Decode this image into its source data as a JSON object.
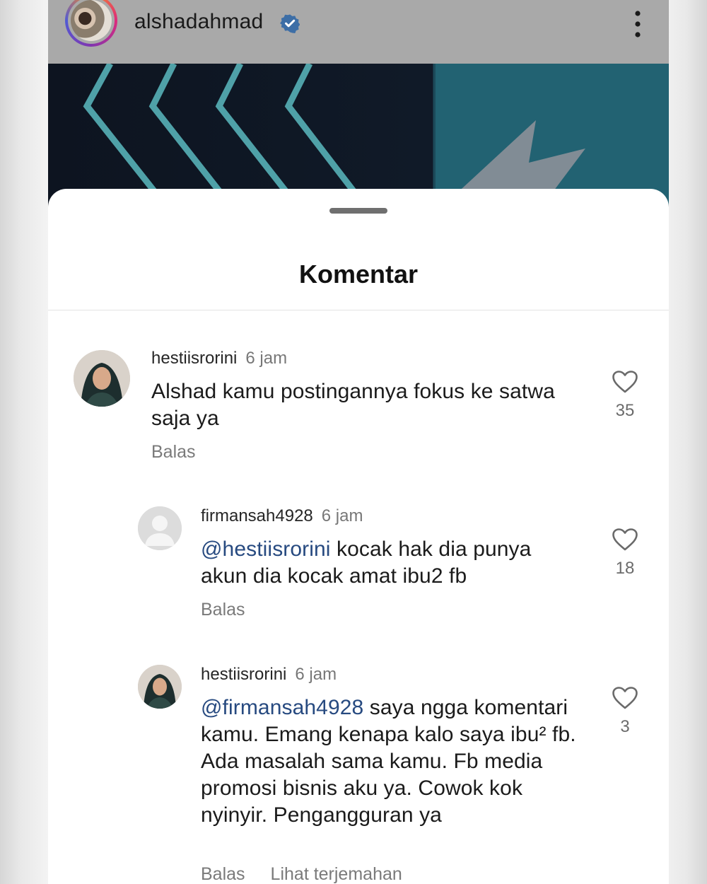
{
  "header": {
    "username": "alshadahmad",
    "verified": true
  },
  "sheet": {
    "title": "Komentar"
  },
  "comments": [
    {
      "username": "hestiisrorini",
      "time": "6 jam",
      "mention": "",
      "text": "Alshad kamu postingannya fokus ke satwa saja ya",
      "reply_label": "Balas",
      "translate_label": "",
      "likes": "35",
      "avatar": "hijab-woman-photo"
    },
    {
      "username": "firmansah4928",
      "time": "6 jam",
      "mention": "@hestiisrorini",
      "text": " kocak hak dia punya akun dia kocak amat ibu2 fb",
      "reply_label": "Balas",
      "translate_label": "",
      "likes": "18",
      "avatar": "default-user-silhouette"
    },
    {
      "username": "hestiisrorini",
      "time": "6 jam",
      "mention": "@firmansah4928",
      "text": " saya ngga komentari kamu. Emang kenapa kalo saya ibu² fb. Ada masalah sama kamu. Fb media promosi bisnis aku ya. Cowok kok nyinyir. Pengangguran ya",
      "reply_label": "Balas",
      "translate_label": "Lihat terjemahan",
      "likes": "3",
      "avatar": "hijab-woman-photo"
    }
  ],
  "icons": {
    "verified": "verified-badge-icon",
    "more": "more-vertical-icon",
    "like": "heart-outline-icon"
  },
  "colors": {
    "verified": "#3897f0",
    "mention": "#274a80",
    "secondary_text": "#777777"
  }
}
